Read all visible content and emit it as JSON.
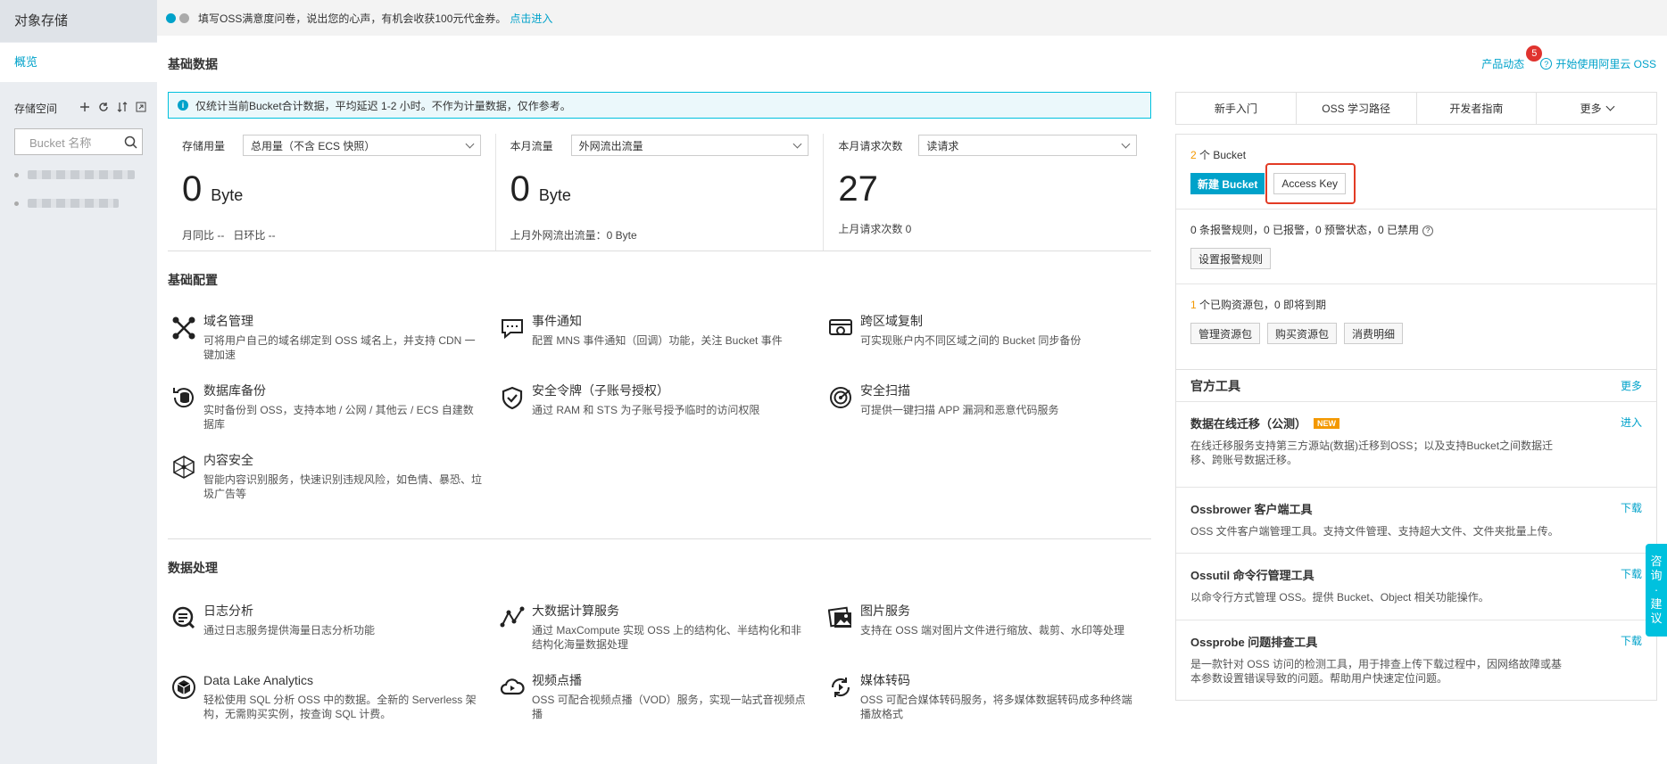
{
  "sidebar": {
    "title": "对象存储",
    "overview": "概览",
    "storage_space": "存储空间",
    "search_placeholder": "Bucket 名称",
    "tool_icons": [
      "plus-icon",
      "refresh-icon",
      "sort-icon",
      "expand-icon"
    ]
  },
  "banner": {
    "text": "填写OSS满意度问卷，说出您的心声，有机会收获100元代金券。",
    "link": "点击进入"
  },
  "header": {
    "basic_data_title": "基础数据",
    "product_news": "产品动态",
    "news_count": "5",
    "start_using": "开始使用阿里云 OSS"
  },
  "notice": {
    "text": "仅统计当前Bucket合计数据，平均延迟 1-2 小时。不作为计量数据，仅作参考。"
  },
  "stats": [
    {
      "label": "存储用量",
      "select": "总用量（不含 ECS 快照）",
      "value": "0",
      "unit": "Byte",
      "sub": "月同比 --   日环比 --"
    },
    {
      "label": "本月流量",
      "select": "外网流出流量",
      "value": "0",
      "unit": "Byte",
      "sub": "上月外网流出流量：0 Byte"
    },
    {
      "label": "本月请求次数",
      "select": "读请求",
      "value": "27",
      "unit": "",
      "sub": "上月请求次数  0"
    }
  ],
  "config": {
    "title": "基础配置",
    "items": [
      {
        "name": "域名管理",
        "desc": "可将用户自己的域名绑定到 OSS 域名上，并支持 CDN 一键加速",
        "icon": "domain-icon"
      },
      {
        "name": "事件通知",
        "desc": "配置 MNS 事件通知（回调）功能，关注 Bucket 事件",
        "icon": "event-icon"
      },
      {
        "name": "跨区域复制",
        "desc": "可实现账户内不同区域之间的 Bucket 同步备份",
        "icon": "replication-icon"
      },
      {
        "name": "数据库备份",
        "desc": "实时备份到 OSS，支持本地 / 公网 / 其他云 / ECS 自建数据库",
        "icon": "database-backup-icon"
      },
      {
        "name": "安全令牌（子账号授权）",
        "desc": "通过 RAM 和 STS 为子账号授予临时的访问权限",
        "icon": "shield-check-icon"
      },
      {
        "name": "安全扫描",
        "desc": "可提供一键扫描 APP 漏洞和恶意代码服务",
        "icon": "radar-icon"
      },
      {
        "name": "内容安全",
        "desc": "智能内容识别服务，快速识别违规风险，如色情、暴恐、垃圾广告等",
        "icon": "content-security-icon"
      }
    ]
  },
  "processing": {
    "title": "数据处理",
    "items": [
      {
        "name": "日志分析",
        "desc": "通过日志服务提供海量日志分析功能",
        "icon": "log-icon"
      },
      {
        "name": "大数据计算服务",
        "desc": "通过 MaxCompute 实现 OSS 上的结构化、半结构化和非结构化海量数据处理",
        "icon": "bigdata-icon"
      },
      {
        "name": "图片服务",
        "desc": "支持在 OSS 端对图片文件进行缩放、裁剪、水印等处理",
        "icon": "image-icon"
      },
      {
        "name": "Data Lake Analytics",
        "desc": "轻松使用 SQL 分析 OSS 中的数据。全新的 Serverless 架构，无需购买实例，按查询 SQL 计费。",
        "icon": "cube-icon"
      },
      {
        "name": "视频点播",
        "desc": "OSS 可配合视频点播（VOD）服务，实现一站式音视频点播",
        "icon": "video-icon"
      },
      {
        "name": "媒体转码",
        "desc": "OSS 可配合媒体转码服务，将多媒体数据转码成多种终端播放格式",
        "icon": "transcode-icon"
      }
    ]
  },
  "tabs": [
    "新手入门",
    "OSS 学习路径",
    "开发者指南",
    "更多"
  ],
  "info": {
    "bucket_count": "2",
    "bucket_label": "个 Bucket",
    "new_bucket": "新建 Bucket",
    "access_key": "Access Key",
    "alarm_text": "0 条报警规则，0 已报警，0 预警状态，0 已禁用",
    "set_alarm": "设置报警规则",
    "pkg_count": "1",
    "pkg_text": "个已购资源包，0 即将到期",
    "manage_pkg": "管理资源包",
    "buy_pkg": "购买资源包",
    "bill": "消费明细"
  },
  "tools": {
    "title": "官方工具",
    "more": "更多",
    "items": [
      {
        "name": "数据在线迁移（公测）",
        "badge": "NEW",
        "action": "进入",
        "desc": "在线迁移服务支持第三方源站(数据)迁移到OSS；以及支持Bucket之间数据迁移、跨账号数据迁移。"
      },
      {
        "name": "Ossbrower 客户端工具",
        "badge": "",
        "action": "下载",
        "desc": "OSS 文件客户端管理工具。支持文件管理、支持超大文件、文件夹批量上传。"
      },
      {
        "name": "Ossutil 命令行管理工具",
        "badge": "",
        "action": "下载",
        "desc": "以命令行方式管理 OSS。提供 Bucket、Object 相关功能操作。"
      },
      {
        "name": "Ossprobe 问题排查工具",
        "badge": "",
        "action": "下载",
        "desc": "是一款针对 OSS 访问的检测工具，用于排查上传下载过程中，因网络故障或基本参数设置错误导致的问题。帮助用户快速定位问题。"
      }
    ]
  },
  "float_tab": [
    "咨",
    "询",
    "·",
    "建",
    "议"
  ],
  "colors": {
    "accent": "#00a2ca",
    "orange": "#f39800",
    "highlight": "#e23b25"
  }
}
